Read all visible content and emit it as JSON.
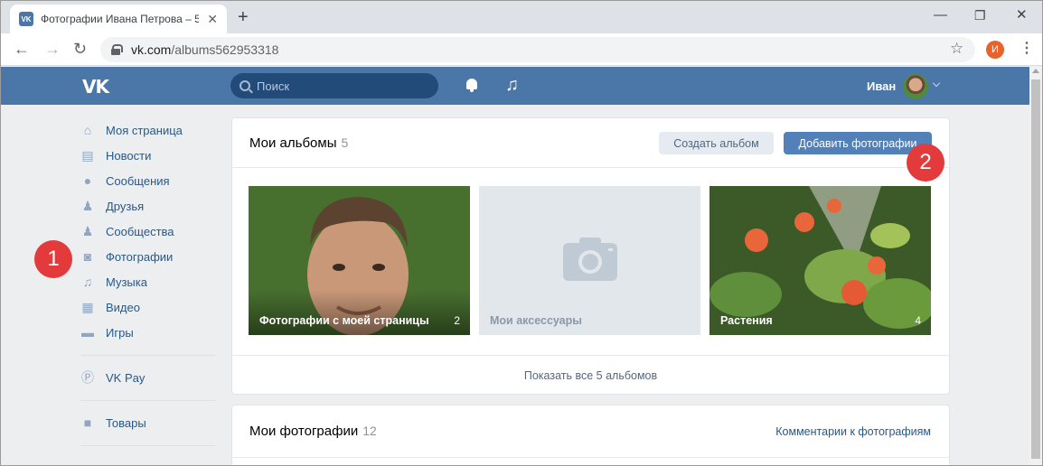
{
  "browser": {
    "tab_title": "Фотографии Ивана Петрова – 5",
    "tab_favicon": "VK",
    "url_host": "vk.com",
    "url_path": "/albums562953318",
    "profile_initial": "И"
  },
  "vk_header": {
    "logo": "VK",
    "search_placeholder": "Поиск",
    "username": "Иван"
  },
  "menu": {
    "items": [
      {
        "label": "Моя страница",
        "icon": "home-icon"
      },
      {
        "label": "Новости",
        "icon": "news-icon"
      },
      {
        "label": "Сообщения",
        "icon": "messages-icon"
      },
      {
        "label": "Друзья",
        "icon": "friends-icon"
      },
      {
        "label": "Сообщества",
        "icon": "groups-icon"
      },
      {
        "label": "Фотографии",
        "icon": "camera-icon"
      },
      {
        "label": "Музыка",
        "icon": "music-icon"
      },
      {
        "label": "Видео",
        "icon": "video-icon"
      },
      {
        "label": "Игры",
        "icon": "gamepad-icon"
      }
    ],
    "vkpay_label": "VK Pay",
    "goods_label": "Товары"
  },
  "callouts": {
    "one": "1",
    "two": "2"
  },
  "albums_card": {
    "title": "Мои альбомы",
    "count": "5",
    "create_label": "Создать альбом",
    "add_label": "Добавить фотографии",
    "albums": [
      {
        "title": "Фотографии с моей страницы",
        "count": "2"
      },
      {
        "title": "Мои аксессуары",
        "count": ""
      },
      {
        "title": "Растения",
        "count": "4"
      }
    ],
    "show_all": "Показать все 5 альбомов"
  },
  "photos_card": {
    "title": "Мои фотографии",
    "count": "12",
    "comments_link": "Комментарии к фотографиям"
  },
  "colors": {
    "vk_blue": "#4a76a8",
    "button_blue": "#5181b8",
    "link": "#2a5885",
    "callout_red": "#e33b3b"
  }
}
